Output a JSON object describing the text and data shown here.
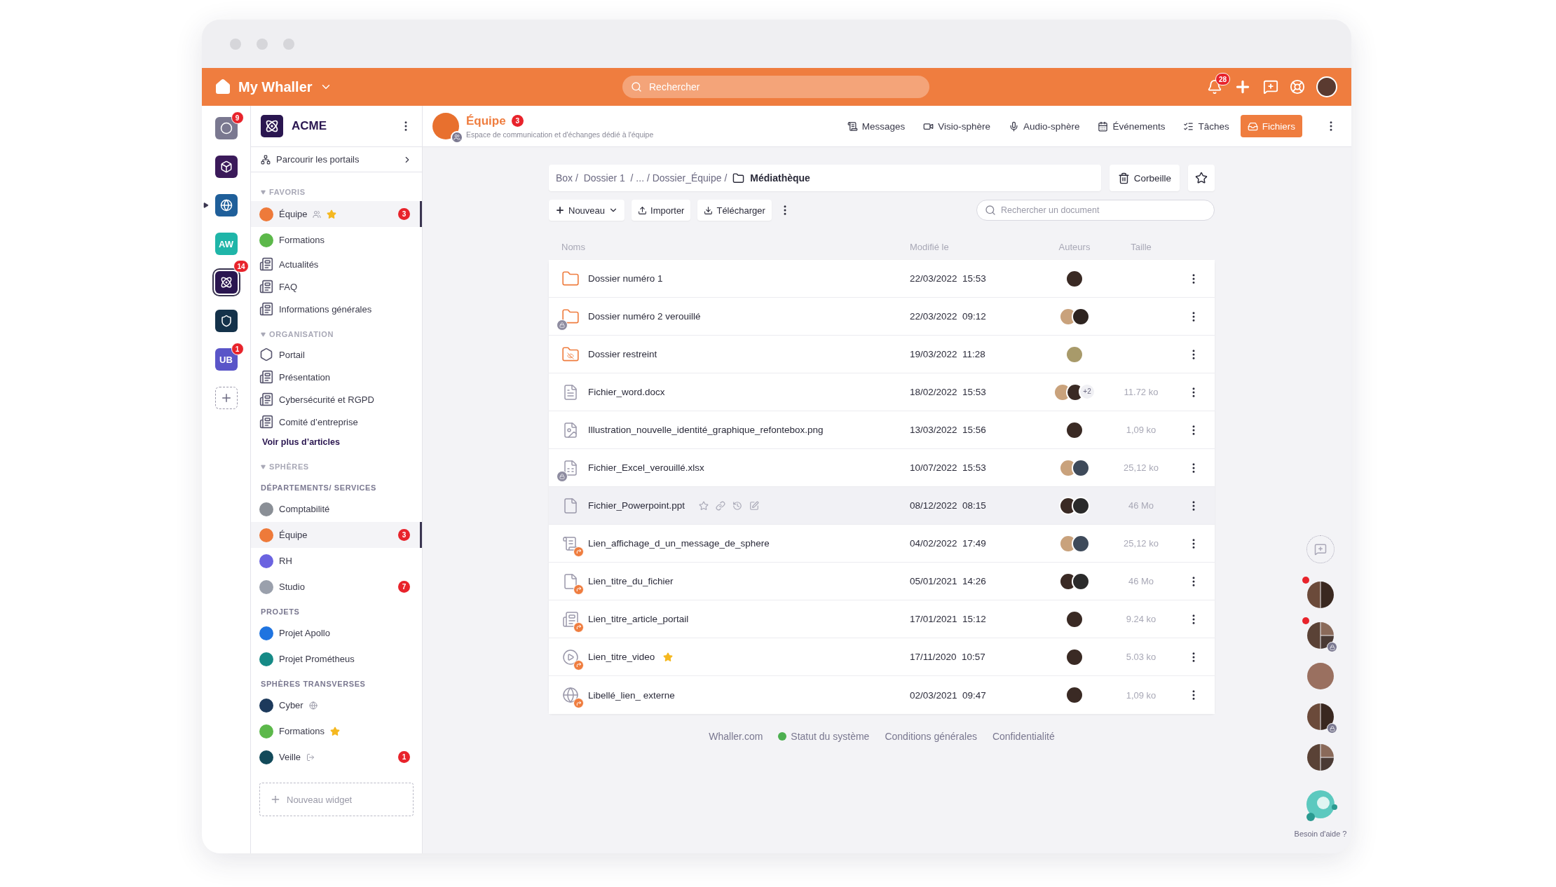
{
  "topbar": {
    "brand": "My Whaller",
    "search_placeholder": "Rechercher",
    "notifications": "28"
  },
  "rail": [
    {
      "kind": "logo",
      "color": "#7a7890",
      "badge": "9",
      "selected": false
    },
    {
      "kind": "logo",
      "color": "#3b1a5a",
      "selected": false
    },
    {
      "kind": "logo",
      "color": "#1f5f9a",
      "selected": false,
      "indicator": true
    },
    {
      "kind": "initials",
      "text": "AW",
      "color": "#1fb5a8",
      "selected": false
    },
    {
      "kind": "logo",
      "color": "#2a1650",
      "badge": "14",
      "selected": true
    },
    {
      "kind": "logo",
      "color": "#14324a",
      "selected": false
    },
    {
      "kind": "initials",
      "text": "UB",
      "color": "#5a55c8",
      "badge": "1",
      "selected": false
    }
  ],
  "org": {
    "name": "ACME",
    "browse": "Parcourir les portails"
  },
  "sections": [
    {
      "kind": "collapsible",
      "title": "FAVORIS",
      "items": [
        {
          "kind": "sphere",
          "label": "Équipe",
          "color": "#ee7a3a",
          "shared": true,
          "starred": true,
          "badge": "3",
          "selected": true
        },
        {
          "kind": "sphere",
          "label": "Formations",
          "color": "#5cb84a",
          "selected": false
        },
        {
          "kind": "article",
          "label": "Actualités",
          "selected": false
        },
        {
          "kind": "article",
          "label": "FAQ",
          "selected": false
        },
        {
          "kind": "article",
          "label": "Informations générales",
          "selected": false
        }
      ]
    },
    {
      "kind": "collapsible",
      "title": "ORGANISATION",
      "more": "Voir plus d’articles",
      "items": [
        {
          "kind": "portal",
          "label": "Portail",
          "selected": false
        },
        {
          "kind": "article",
          "label": "Présentation",
          "selected": false
        },
        {
          "kind": "article",
          "label": "Cybersécurité et RGPD",
          "selected": false
        },
        {
          "kind": "article",
          "label": "Comité d’entreprise",
          "selected": false
        }
      ]
    },
    {
      "kind": "collapsible",
      "title": "SPHÈRES"
    },
    {
      "kind": "group",
      "title": "DÉPARTEMENTS/ SERVICES",
      "items": [
        {
          "kind": "sphere",
          "label": "Comptabilité",
          "color": "#8a8f96",
          "selected": false
        },
        {
          "kind": "sphere",
          "label": "Équipe",
          "color": "#ee7a3a",
          "badge": "3",
          "selected": true
        },
        {
          "kind": "sphere",
          "label": "RH",
          "color": "#6b63e0",
          "selected": false
        },
        {
          "kind": "sphere",
          "label": "Studio",
          "color": "#9aa0ac",
          "badge": "7",
          "selected": false
        }
      ]
    },
    {
      "kind": "group",
      "title": "PROJETS",
      "items": [
        {
          "kind": "sphere",
          "label": "Projet Apollo",
          "color": "#1f74e0",
          "selected": false
        },
        {
          "kind": "sphere",
          "label": "Projet Prométheus",
          "color": "#168a86",
          "selected": false
        }
      ]
    },
    {
      "kind": "group",
      "title": "SPHÈRES TRANSVERSES",
      "items": [
        {
          "kind": "sphere",
          "label": "Cyber",
          "color": "#1d3a5c",
          "public": true,
          "selected": false
        },
        {
          "kind": "sphere",
          "label": "Formations",
          "color": "#5cb84a",
          "starred": true,
          "selected": false
        },
        {
          "kind": "sphere",
          "label": "Veille",
          "color": "#124a5a",
          "archived": true,
          "badge": "1",
          "selected": false
        }
      ]
    }
  ],
  "new_widget": "Nouveau widget",
  "header": {
    "title": "Équipe",
    "badge": "3",
    "subtitle": "Espace de communication et d'échanges dédié à l'équipe",
    "tabs": [
      {
        "label": "Messages",
        "selected": false
      },
      {
        "label": "Visio-sphère",
        "selected": false
      },
      {
        "label": "Audio-sphère",
        "selected": false
      },
      {
        "label": "Événements",
        "selected": false
      },
      {
        "label": "Tâches",
        "selected": false
      },
      {
        "label": "Fichiers",
        "selected": true
      }
    ]
  },
  "breadcrumb": {
    "path": "Box /  Dossier 1  / ... / Dossier_Équipe /",
    "current": "Médiathèque"
  },
  "trash": "Corbeille",
  "toolbar": {
    "new": "Nouveau",
    "import": "Importer",
    "download": "Télécharger",
    "search_placeholder": "Rechercher un document"
  },
  "columns": [
    "Noms",
    "Modifié le",
    "Auteurs",
    "Taille"
  ],
  "rows": [
    {
      "kind": "folder",
      "name": "Dossier numéro 1",
      "date": "22/03/2022",
      "time": "15:53",
      "authors": [
        {
          "color": "#3a2a24"
        }
      ],
      "locked": false,
      "link": false,
      "selected": false
    },
    {
      "kind": "folder",
      "name": "Dossier numéro 2 verouillé",
      "date": "22/03/2022",
      "time": "09:12",
      "authors": [
        {
          "color": "#c9a27c"
        },
        {
          "color": "#2e2420"
        }
      ],
      "locked": true,
      "link": false,
      "selected": false
    },
    {
      "kind": "restricted",
      "name": "Dossier restreint",
      "date": "19/03/2022",
      "time": "11:28",
      "authors": [
        {
          "color": "#a89a6a"
        }
      ],
      "locked": false,
      "link": false,
      "selected": false
    },
    {
      "kind": "word",
      "name": "Fichier_word.docx",
      "date": "18/02/2022",
      "time": "15:53",
      "authors": [
        {
          "color": "#c9a27c"
        },
        {
          "color": "#3a2a24"
        }
      ],
      "more": "+2",
      "size": "11.72 ko",
      "locked": false,
      "link": false,
      "selected": false
    },
    {
      "name": "Illustration_nouvelle_identité_graphique_refontebox.png",
      "date": "13/03/2022",
      "time": "15:56",
      "authors": [
        {
          "color": "#3a2a24"
        }
      ],
      "size": "1,09 ko",
      "locked": false,
      "link": false,
      "selected": false
    },
    {
      "kind": "excel",
      "name": "Fichier_Excel_verouillé.xlsx",
      "date": "10/07/2022",
      "time": "15:53",
      "authors": [
        {
          "color": "#c9a27c"
        },
        {
          "color": "#3e4a5a"
        }
      ],
      "size": "25,12 ko",
      "locked": true,
      "link": false,
      "selected": false
    },
    {
      "kind": "powerpoint",
      "name": "Fichier_Powerpoint.ppt",
      "date": "08/12/2022",
      "time": "08:15",
      "authors": [
        {
          "color": "#3a2a24"
        },
        {
          "color": "#2a2a2a"
        }
      ],
      "size": "46 Mo",
      "locked": false,
      "link": false,
      "selected": true
    },
    {
      "kind": "message",
      "name": "Lien_affichage_d_un_message_de_sphere",
      "date": "04/02/2022",
      "time": "17:49",
      "authors": [
        {
          "color": "#c9a27c"
        },
        {
          "color": "#3e4a5a"
        }
      ],
      "size": "25,12 ko",
      "locked": false,
      "link": true,
      "selected": false
    },
    {
      "kind": "file",
      "name": "Lien_titre_du_fichier",
      "date": "05/01/2021",
      "time": "14:26",
      "authors": [
        {
          "color": "#3a2a24"
        },
        {
          "color": "#2a2a2a"
        }
      ],
      "size": "46 Mo",
      "locked": false,
      "link": true,
      "selected": false
    },
    {
      "kind": "article",
      "name": "Lien_titre_article_portail",
      "date": "17/01/2021",
      "time": "15:12",
      "authors": [
        {
          "color": "#3a2a24"
        }
      ],
      "size": "9.24 ko",
      "locked": false,
      "link": true,
      "selected": false
    },
    {
      "kind": "video",
      "name": "Lien_titre_video",
      "date": "17/11/2020",
      "time": "10:57",
      "authors": [
        {
          "color": "#3a2a24"
        }
      ],
      "size": "5.03 ko",
      "starred": true,
      "locked": false,
      "link": true,
      "selected": false
    },
    {
      "kind": "web",
      "name": "Libellé_lien_ externe",
      "date": "02/03/2021",
      "time": "09:47",
      "authors": [
        {
          "color": "#3a2a24"
        }
      ],
      "size": "1,09 ko",
      "locked": false,
      "link": true,
      "selected": false
    }
  ],
  "footer": [
    {
      "kind": "link",
      "text": "Whaller.com"
    },
    {
      "kind": "status",
      "text": "Statut du système",
      "color": "#4caf50"
    },
    {
      "kind": "link",
      "text": "Conditions générales"
    },
    {
      "kind": "link",
      "text": "Confidentialité"
    }
  ],
  "conversations": [
    {
      "kind": "duo",
      "unread": true,
      "locked": false
    },
    {
      "kind": "group",
      "unread": true,
      "locked": true
    },
    {
      "kind": "single",
      "unread": false,
      "locked": false
    },
    {
      "kind": "duo",
      "unread": false,
      "locked": true
    },
    {
      "kind": "group",
      "unread": false,
      "locked": false
    }
  ],
  "help": "Besoin d'aide ?"
}
